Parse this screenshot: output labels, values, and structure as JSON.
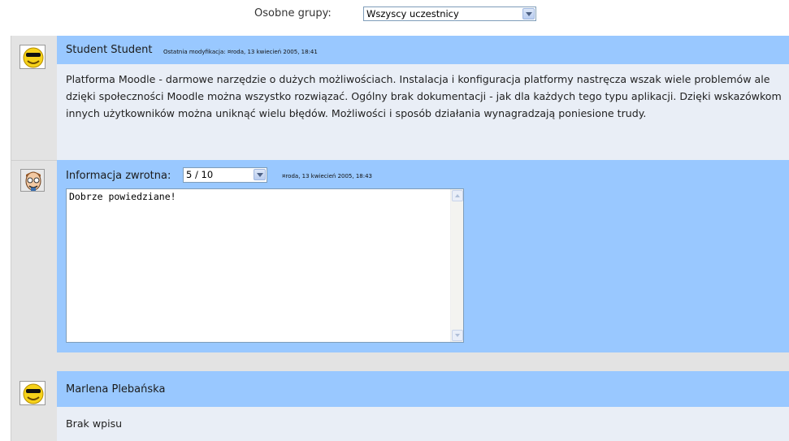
{
  "groups": {
    "label": "Osobne grupy:",
    "selected": "Wszyscy uczestnicy"
  },
  "entries": [
    {
      "author": "Student Student",
      "modified": "Ostatnia modyfikacja: ¤roda, 13 kwiecień 2005, 18:41",
      "text": "Platforma Moodle - darmowe narzędzie o dużych możliwościach. Instalacja i konfiguracja platformy nastręcza wszak wiele problemów ale dzięki społeczności Moodle można wszystko rozwiązać. Ogólny brak dokumentacji - jak dla każdych tego typu aplikacji. Dzięki wskazówkom innych użytkowników można uniknąć wielu błędów. Możliwości i sposób działania wynagradzają poniesione trudy.",
      "feedback": {
        "label": "Informacja zwrotna:",
        "grade": "5 / 10",
        "date": "¤roda, 13 kwiecień 2005, 18:43",
        "comment": "Dobrze powiedziane!"
      }
    },
    {
      "author": "Marlena Plebańska",
      "text": "Brak wpisu"
    }
  ]
}
